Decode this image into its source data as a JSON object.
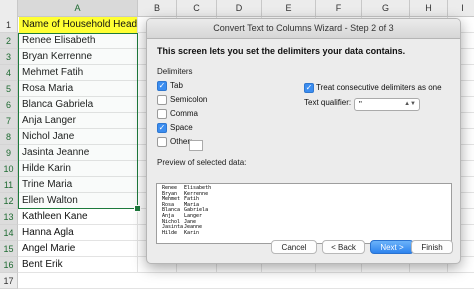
{
  "sheet": {
    "columns": [
      "A",
      "B",
      "C",
      "D",
      "E",
      "F",
      "G",
      "H",
      "I"
    ],
    "rows": [
      "1",
      "2",
      "3",
      "4",
      "5",
      "6",
      "7",
      "8",
      "9",
      "10",
      "11",
      "12",
      "13",
      "14",
      "15",
      "16",
      "17"
    ],
    "cells": [
      "Name of Household Head",
      "Renee Elisabeth",
      "Bryan Kerrenne",
      "Mehmet Fatih",
      "Rosa Maria",
      "Blanca Gabriela",
      "Anja Langer",
      "Nichol Jane",
      "Jasinta Jeanne",
      "Hilde Karin",
      "Trine Maria",
      "Ellen Walton",
      "Kathleen Kane",
      "Hanna Agla",
      "Angel Marie",
      "Bent Erik"
    ],
    "header_color": "#ffff33",
    "selection_color": "#1d7a3c"
  },
  "dialog": {
    "title": "Convert Text to Columns Wizard - Step 2 of 3",
    "instruction": "This screen lets you set the delimiters your data contains.",
    "delimiters_label": "Delimiters",
    "options": [
      {
        "label": "Tab",
        "checked": true
      },
      {
        "label": "Semicolon",
        "checked": false
      },
      {
        "label": "Comma",
        "checked": false
      },
      {
        "label": "Space",
        "checked": true
      },
      {
        "label": "Other:",
        "checked": false
      }
    ],
    "consecutive_label": "Treat consecutive delimiters as one",
    "consecutive_checked": true,
    "qualifier_label": "Text qualifier:",
    "qualifier_value": "\"",
    "preview_label": "Preview of selected data:",
    "preview_rows": [
      [
        "Renee",
        "Elisabeth"
      ],
      [
        "Bryan",
        "Kerrenne"
      ],
      [
        "Mehmet",
        "Fatih"
      ],
      [
        "Rosa",
        "Maria"
      ],
      [
        "Blanca",
        "Gabriela"
      ],
      [
        "Anja",
        "Langer"
      ],
      [
        "Nichol",
        "Jane"
      ],
      [
        "Jasinta",
        "Jeanne"
      ],
      [
        "Hilde",
        "Karin"
      ]
    ],
    "buttons": {
      "cancel": "Cancel",
      "back": "< Back",
      "next": "Next >",
      "finish": "Finish"
    },
    "accent_color": "#2d83ee"
  }
}
